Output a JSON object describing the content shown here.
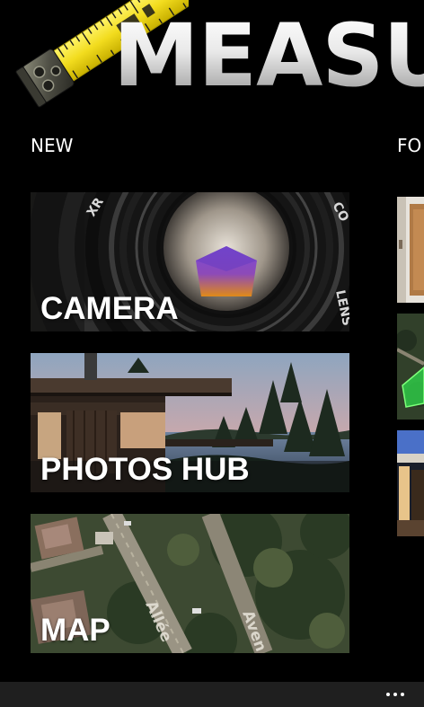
{
  "app": {
    "title": "MEASURE"
  },
  "sections": {
    "current": "NEW",
    "next": "FO"
  },
  "tiles": [
    {
      "label": "CAMERA"
    },
    {
      "label": "PHOTOS HUB"
    },
    {
      "label": "MAP"
    }
  ],
  "icons": {
    "logo": "tape-measure-icon",
    "more": "ellipsis-icon"
  },
  "colors": {
    "background": "#000000",
    "app_bar": "#1f1f1f",
    "tape_yellow": "#f2dc1e",
    "label": "#ffffff"
  }
}
